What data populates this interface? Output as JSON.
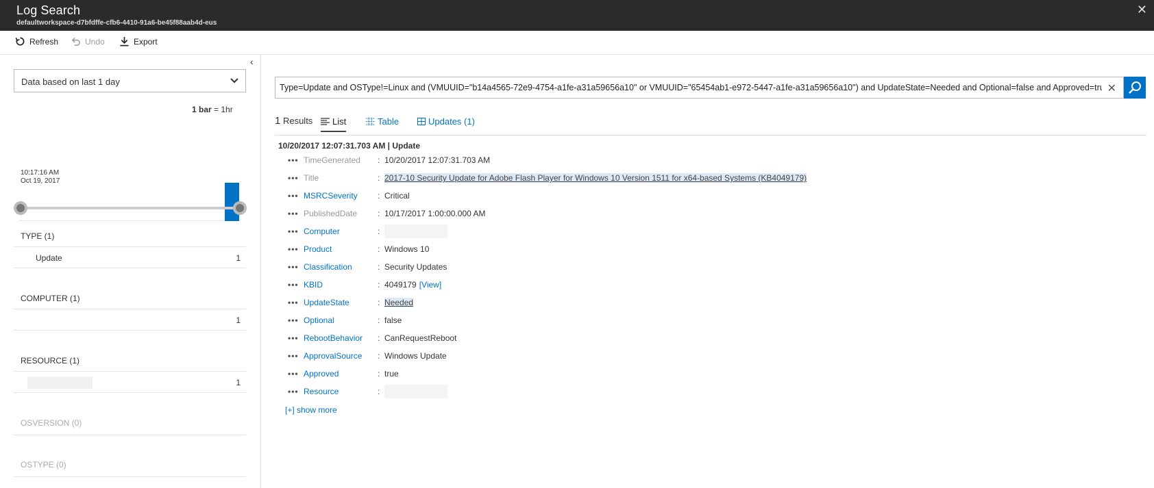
{
  "header": {
    "title": "Log Search",
    "subtitle": "defaultworkspace-d7bfdffe-cfb6-4410-91a6-be45f88aab4d-eus",
    "close": "✕"
  },
  "toolbar": {
    "refresh": "Refresh",
    "undo": "Undo",
    "export": "Export"
  },
  "left": {
    "collapse": "‹",
    "time_range": "Data based on last 1 day",
    "bar_legend_bold": "1 bar",
    "bar_legend_rest": " = 1hr",
    "chart_time": "10:17:16 AM",
    "chart_date": "Oct 19, 2017",
    "facets": [
      {
        "label": "TYPE  (1)",
        "row_name": "Update",
        "row_count": "1"
      },
      {
        "label": "COMPUTER  (1)",
        "row_name": "",
        "row_count": "1"
      },
      {
        "label": "RESOURCE  (1)",
        "row_name": "",
        "row_count": "1"
      },
      {
        "label": "OSVERSION  (0)"
      },
      {
        "label": "OSTYPE  (0)"
      }
    ]
  },
  "chart_data": {
    "type": "bar",
    "values": [
      1
    ],
    "x": [
      "10:17:16 AM Oct 19, 2017"
    ],
    "bar_interval": "1hr"
  },
  "query": {
    "text": "Type=Update and OSType!=Linux and (VMUUID=\"b14a4565-72e9-4754-a1fe-a31a59656a10\" or VMUUID=\"65454ab1-e972-5447-a1fe-a31a59656a10\") and UpdateState=Needed and Optional=false and Approved=true",
    "clear": "✕"
  },
  "results": {
    "count": "1",
    "count_label": " Results",
    "tabs": [
      "List",
      "Table",
      "Updates (1)"
    ]
  },
  "record": {
    "header": "10/20/2017 12:07:31.703 AM | Update",
    "fields": [
      {
        "key": "TimeGenerated",
        "value": "10/20/2017 12:07:31.703 AM"
      },
      {
        "key": "Title",
        "value": "2017-10 Security Update for Adobe Flash Player for Windows 10 Version 1511 for x64-based Systems (KB4049179)"
      },
      {
        "key": "MSRCSeverity",
        "value": "Critical"
      },
      {
        "key": "PublishedDate",
        "value": "10/17/2017 1:00:00.000 AM"
      },
      {
        "key": "Computer",
        "value": ""
      },
      {
        "key": "Product",
        "value": "Windows 10"
      },
      {
        "key": "Classification",
        "value": "Security Updates"
      },
      {
        "key": "KBID",
        "value": "4049179",
        "link": "[View]"
      },
      {
        "key": "UpdateState",
        "value": "Needed"
      },
      {
        "key": "Optional",
        "value": "false"
      },
      {
        "key": "RebootBehavior",
        "value": "CanRequestReboot"
      },
      {
        "key": "ApprovalSource",
        "value": "Windows Update"
      },
      {
        "key": "Approved",
        "value": "true"
      },
      {
        "key": "Resource",
        "value": ""
      }
    ],
    "show_more": "[+] show more"
  }
}
